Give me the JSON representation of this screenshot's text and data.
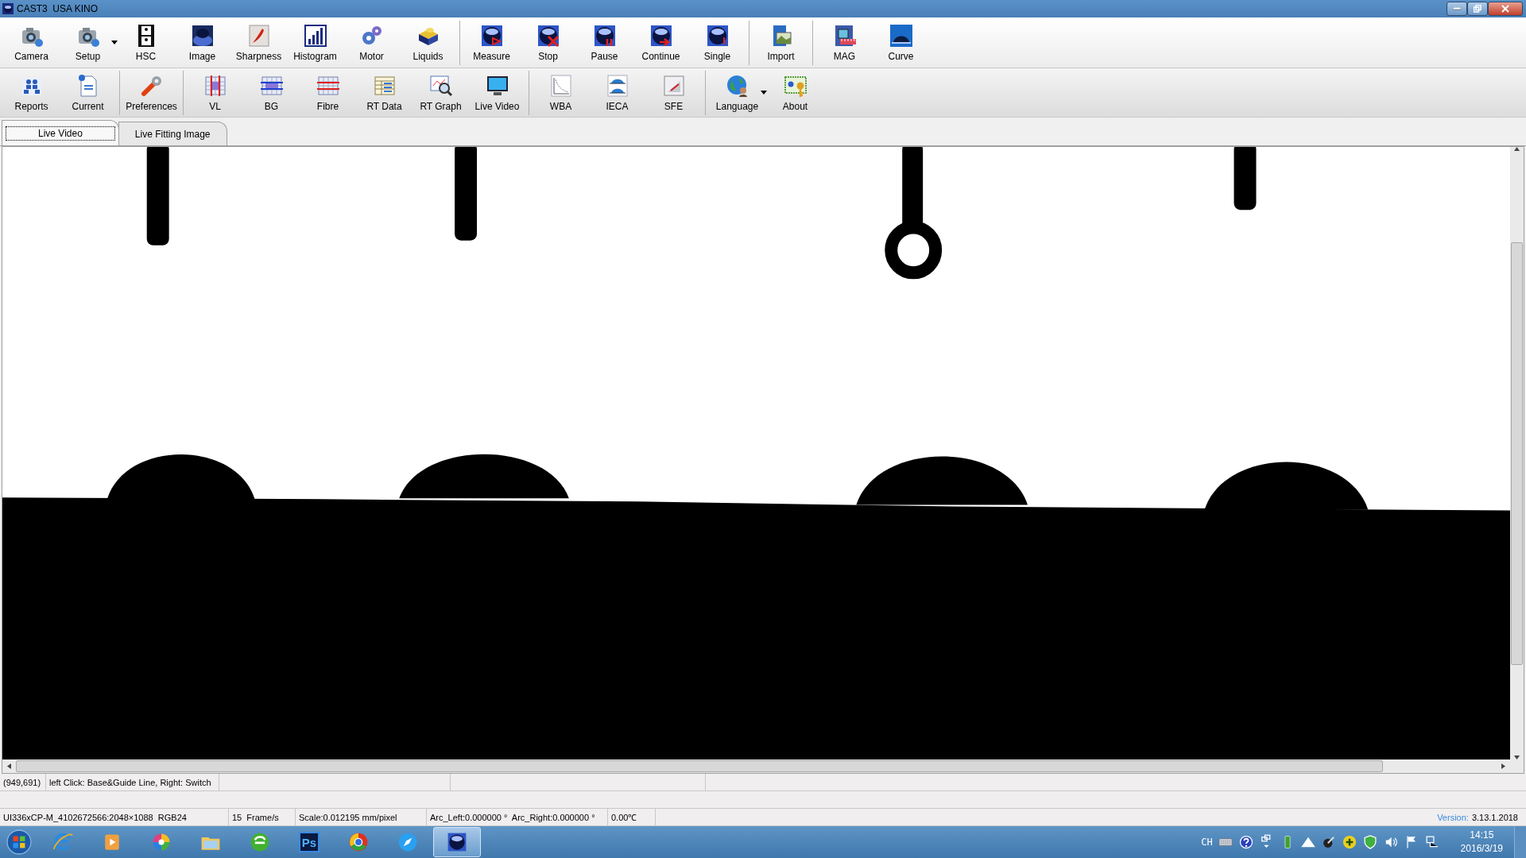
{
  "window": {
    "title": "CAST3  USA KINO"
  },
  "toolbars": [
    {
      "groups": [
        [
          {
            "label": "Camera",
            "has_menu": false
          },
          {
            "label": "Setup",
            "has_menu": true
          },
          {
            "label": "HSC",
            "has_menu": false
          },
          {
            "label": "Image",
            "has_menu": false
          },
          {
            "label": "Sharpness",
            "has_menu": false
          },
          {
            "label": "Histogram",
            "has_menu": false
          },
          {
            "label": "Motor",
            "has_menu": false
          },
          {
            "label": "Liquids",
            "has_menu": false
          }
        ],
        [
          {
            "label": "Measure",
            "has_menu": false
          },
          {
            "label": "Stop",
            "has_menu": false
          },
          {
            "label": "Pause",
            "has_menu": false
          },
          {
            "label": "Continue",
            "has_menu": false
          },
          {
            "label": "Single",
            "has_menu": false
          }
        ],
        [
          {
            "label": "Import",
            "has_menu": false
          }
        ],
        [
          {
            "label": "MAG",
            "has_menu": false
          },
          {
            "label": "Curve",
            "has_menu": false
          }
        ]
      ]
    },
    {
      "groups": [
        [
          {
            "label": "Reports",
            "has_menu": false
          },
          {
            "label": "Current",
            "has_menu": false
          }
        ],
        [
          {
            "label": "Preferences",
            "has_menu": false
          }
        ],
        [
          {
            "label": "VL",
            "has_menu": false
          },
          {
            "label": "BG",
            "has_menu": false
          },
          {
            "label": "Fibre",
            "has_menu": false
          },
          {
            "label": "RT Data",
            "has_menu": false
          },
          {
            "label": "RT Graph",
            "has_menu": false
          },
          {
            "label": "Live Video",
            "has_menu": false
          }
        ],
        [
          {
            "label": "WBA",
            "has_menu": false
          },
          {
            "label": "IECA",
            "has_menu": false
          },
          {
            "label": "SFE",
            "has_menu": false
          }
        ],
        [
          {
            "label": "Language",
            "has_menu": true
          },
          {
            "label": "About",
            "has_menu": false
          }
        ]
      ]
    }
  ],
  "tabs": [
    {
      "label": "Live Video",
      "selected": true
    },
    {
      "label": "Live Fitting Image",
      "selected": false
    }
  ],
  "status_bar": {
    "position": "(949,691)",
    "hint": "left Click: Base&Guide Line, Right: Switch",
    "camera": "UI336xCP-M_4102672566:2048×1088  RGB24",
    "frame_rate": "15  Frame/s",
    "scale": "Scale:0.012195 mm/pixel",
    "arc": "Arc_Left:0.000000 °  Arc_Right:0.000000 °",
    "temperature": "0.00℃",
    "version_label": "Version:",
    "version": "3.13.1.2018"
  },
  "taskbar": {
    "apps": [
      {
        "active": false
      },
      {
        "active": false
      },
      {
        "active": false
      },
      {
        "active": false
      },
      {
        "active": false
      },
      {
        "active": false,
        "label": "Ps"
      },
      {
        "active": false
      },
      {
        "active": false
      },
      {
        "active": true
      }
    ],
    "language": "CH",
    "time": "14:15",
    "date": "2016/3/19"
  }
}
